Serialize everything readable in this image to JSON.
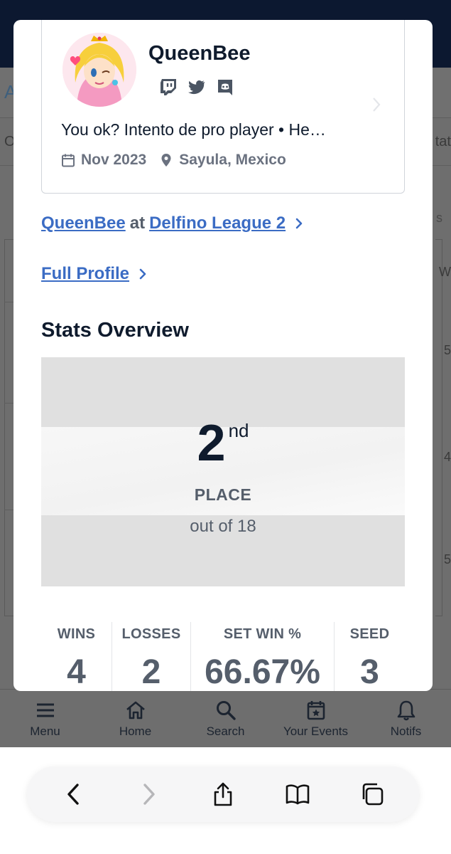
{
  "profile": {
    "name": "QueenBee",
    "bio": "You ok? Intento de pro player • He…",
    "joined": "Nov 2023",
    "location": "Sayula, Mexico",
    "socials": [
      "twitch-icon",
      "twitter-icon",
      "discord-icon"
    ]
  },
  "links": {
    "player": "QueenBee",
    "at": "at",
    "league": "Delfino League 2",
    "full_profile": "Full Profile"
  },
  "stats": {
    "title": "Stats Overview",
    "place_number": "2",
    "place_suffix": "nd",
    "place_label": "PLACE",
    "out_of": "out of 18",
    "items": [
      {
        "label": "WINS",
        "value": "4"
      },
      {
        "label": "LOSSES",
        "value": "2"
      },
      {
        "label": "SET WIN %",
        "value": "66.67%"
      },
      {
        "label": "SEED",
        "value": "3"
      }
    ]
  },
  "background": {
    "left_letter": "A",
    "left_letter2": "O",
    "right_text": "tat",
    "right_s": "s",
    "right_w": "W",
    "right_nums": [
      "5",
      "4",
      "5"
    ]
  },
  "nav": {
    "items": [
      {
        "label": "Menu",
        "icon": "menu-icon"
      },
      {
        "label": "Home",
        "icon": "home-icon"
      },
      {
        "label": "Search",
        "icon": "search-icon"
      },
      {
        "label": "Your Events",
        "icon": "calendar-star-icon"
      },
      {
        "label": "Notifs",
        "icon": "bell-icon"
      }
    ]
  },
  "colors": {
    "link": "#3b6cc4",
    "header": "#0c1830",
    "text_dark": "#0f1b2d",
    "text_muted": "#555e6b"
  }
}
